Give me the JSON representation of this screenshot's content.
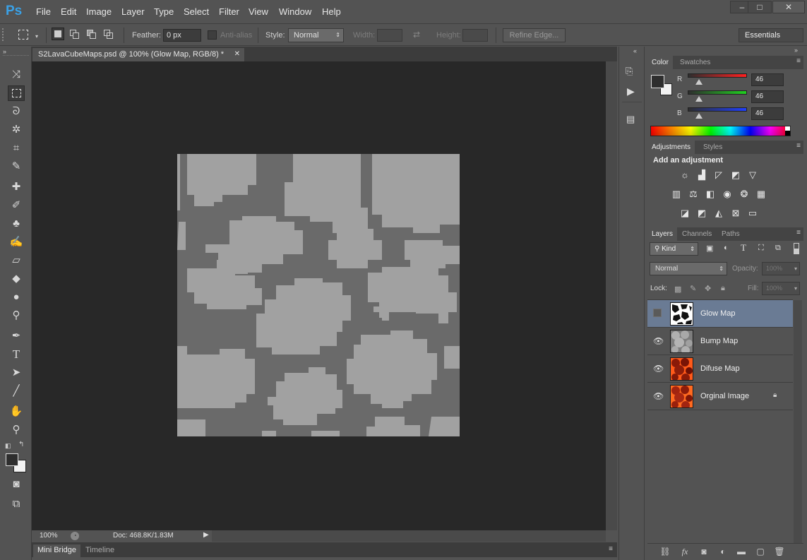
{
  "app": {
    "logo": "Ps"
  },
  "menu": [
    "File",
    "Edit",
    "Image",
    "Layer",
    "Type",
    "Select",
    "Filter",
    "View",
    "Window",
    "Help"
  ],
  "window_controls": [
    "–",
    "□",
    "✕"
  ],
  "options": {
    "feather_label": "Feather:",
    "feather_value": "0 px",
    "antialias_label": "Anti-alias",
    "style_label": "Style:",
    "style_value": "Normal",
    "width_label": "Width:",
    "height_label": "Height:",
    "refine_edge": "Refine Edge...",
    "workspace": "Essentials"
  },
  "document": {
    "tab_title": "S2LavaCubeMaps.psd @ 100% (Glow Map, RGB/8) *",
    "zoom": "100%",
    "doc_size": "Doc: 468.8K/1.83M"
  },
  "bottom_tabs": [
    "Mini Bridge",
    "Timeline"
  ],
  "color_panel": {
    "tabs": [
      "Color",
      "Swatches"
    ],
    "channels": [
      {
        "label": "R",
        "value": "46",
        "gradient": "#ff2020"
      },
      {
        "label": "G",
        "value": "46",
        "gradient": "#20d020"
      },
      {
        "label": "B",
        "value": "46",
        "gradient": "#2040ff"
      }
    ]
  },
  "adjustments_panel": {
    "tabs": [
      "Adjustments",
      "Styles"
    ],
    "heading": "Add an adjustment"
  },
  "layers_panel": {
    "tabs": [
      "Layers",
      "Channels",
      "Paths"
    ],
    "filter_kind": "Kind",
    "blend_mode": "Normal",
    "opacity_label": "Opacity:",
    "opacity_value": "100%",
    "lock_label": "Lock:",
    "fill_label": "Fill:",
    "fill_value": "100%",
    "layers": [
      {
        "name": "Glow Map",
        "visible": false,
        "selected": true
      },
      {
        "name": "Bump Map",
        "visible": true,
        "selected": false
      },
      {
        "name": "Difuse Map",
        "visible": true,
        "selected": false
      },
      {
        "name": "Orginal Image",
        "visible": true,
        "selected": false,
        "locked": true
      }
    ]
  },
  "colors": {
    "ui_bg": "#535353",
    "canvas_bg": "#282828",
    "selection": "#6a7b94",
    "glow_light": "#a1a1a1",
    "glow_dark": "#6a6a6a"
  }
}
